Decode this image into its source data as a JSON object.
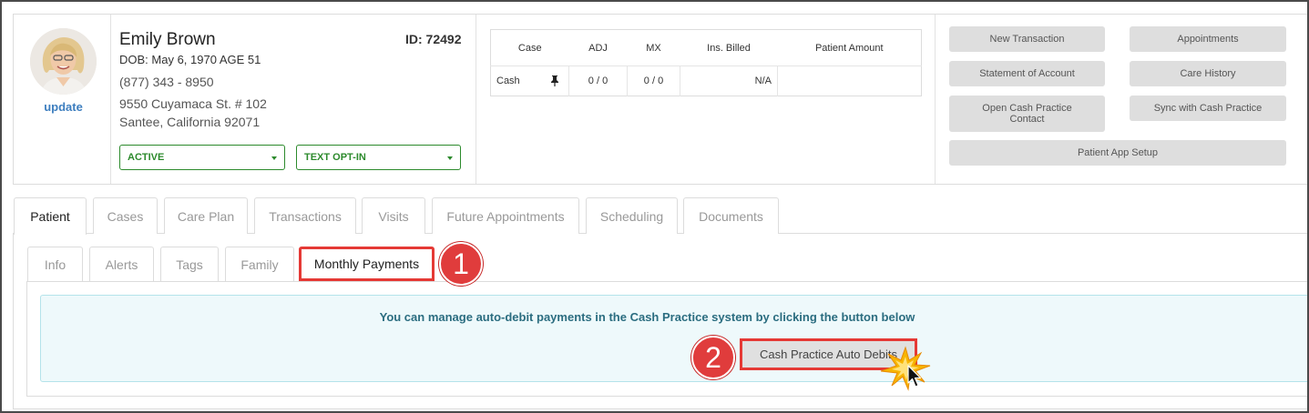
{
  "patient": {
    "update_label": "update",
    "name": "Emily Brown",
    "id_label": "ID: 72492",
    "dob_line": "DOB: May 6, 1970 AGE 51",
    "phone": "(877) 343 - 8950",
    "address_line1": "9550 Cuyamaca St. # 102",
    "address_line2": "Santee, California 92071",
    "status_value": "ACTIVE",
    "text_opt_value": "TEXT OPT-IN"
  },
  "case_table": {
    "headers": [
      "Case",
      "ADJ",
      "MX",
      "Ins. Billed",
      "Patient Amount"
    ],
    "row": [
      "Cash",
      "0 / 0",
      "0 / 0",
      "N/A",
      ""
    ]
  },
  "actions": {
    "new_transaction": "New Transaction",
    "appointments": "Appointments",
    "statement_of_account": "Statement of Account",
    "care_history": "Care History",
    "open_cash_practice_contact": "Open Cash Practice Contact",
    "sync_with_cash_practice": "Sync with Cash Practice",
    "patient_app_setup": "Patient App Setup"
  },
  "tabs": [
    "Patient",
    "Cases",
    "Care Plan",
    "Transactions",
    "Visits",
    "Future Appointments",
    "Scheduling",
    "Documents"
  ],
  "subtabs": [
    "Info",
    "Alerts",
    "Tags",
    "Family",
    "Monthly Payments"
  ],
  "monthly_payments": {
    "message": "You can manage auto-debit payments in the Cash Practice system by clicking the button below",
    "button_label": "Cash Practice Auto Debits"
  },
  "callouts": [
    "1",
    "2"
  ],
  "colors": {
    "active_green": "#2c8a2c",
    "link_blue": "#3d7ebf",
    "highlight_red": "#e53935",
    "info_teal": "#2b6d80"
  },
  "icons": [
    "pin-icon",
    "caret-down-icon",
    "cursor-icon",
    "click-burst-icon"
  ]
}
